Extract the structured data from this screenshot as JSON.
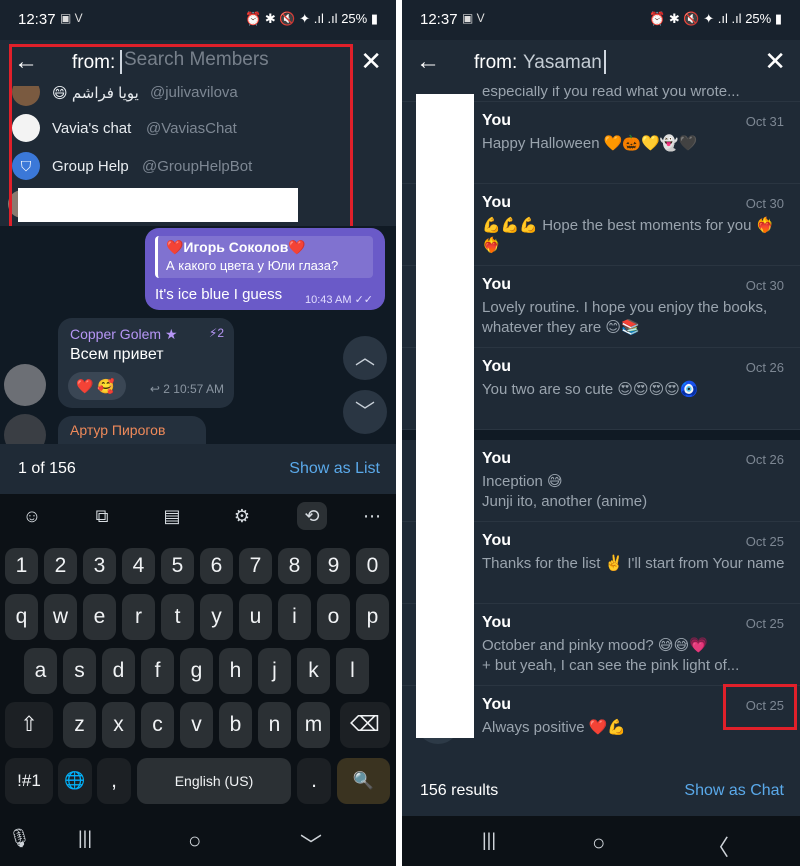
{
  "left": {
    "status": {
      "time": "12:37",
      "left_icons": "▣ V",
      "right_icons": "⏰ ✱ 🔇 ✦ .ıl .ıl",
      "battery": "25%"
    },
    "search": {
      "prefix": "from:",
      "placeholder": "Search Members"
    },
    "members": [
      {
        "name": "يويا فراشم",
        "username": "@julivavilova",
        "emoji": "😄"
      },
      {
        "name": "Vavia's chat",
        "username": "@VaviasChat"
      },
      {
        "name": "Group Help",
        "username": "@GroupHelpBot"
      }
    ],
    "chat": {
      "outgoing": {
        "reply_name": "❤️Игорь Соколов❤️",
        "reply_text": "А какого цвета у Юли глаза?",
        "text": "It's ice blue I guess",
        "time": "10:43 AM",
        "ticks": "✓✓"
      },
      "incoming": {
        "sender": "Copper Golem",
        "star": "★",
        "boost": "⚡2",
        "text": "Всем привет",
        "reactions": "❤️ 🥰",
        "reply_count": "↩ 2",
        "time": "10:57 AM"
      },
      "peek_sender": "Артур Пирогов"
    },
    "result_bar": {
      "count": "1 of 156",
      "action": "Show as List"
    },
    "keyboard": {
      "tools": [
        "☺",
        "⧉",
        "▤",
        "⚙",
        "⟲",
        "⋯"
      ],
      "numbers": [
        "1",
        "2",
        "3",
        "4",
        "5",
        "6",
        "7",
        "8",
        "9",
        "0"
      ],
      "row1": [
        "q",
        "w",
        "e",
        "r",
        "t",
        "y",
        "u",
        "i",
        "o",
        "p"
      ],
      "row2": [
        "a",
        "s",
        "d",
        "f",
        "g",
        "h",
        "j",
        "k",
        "l"
      ],
      "row3": [
        "z",
        "x",
        "c",
        "v",
        "b",
        "n",
        "m"
      ],
      "shift": "⇧",
      "backspace": "⌫",
      "sym": "!#1",
      "globe": "🌐",
      "comma": ",",
      "space": "English (US)",
      "period": ".",
      "search": "🔍"
    },
    "navbar": {
      "recents": "|||",
      "home": "○",
      "back": "﹀"
    }
  },
  "right": {
    "status": {
      "time": "12:37",
      "left_icons": "▣ V",
      "right_icons": "⏰ ✱ 🔇 ✦ .ıl .ıl",
      "battery": "25%"
    },
    "search": {
      "prefix": "from:",
      "value": "Yasaman"
    },
    "partial_text": "especially if you read what you wrote...",
    "results": [
      {
        "sender": "You",
        "date": "Oct 31",
        "text": "Happy Halloween 🧡🎃💛👻🖤"
      },
      {
        "sender": "You",
        "date": "Oct 30",
        "text": "💪💪💪 Hope the best moments for you ❤️‍🔥❤️‍🔥"
      },
      {
        "sender": "You",
        "date": "Oct 30",
        "text": "Lovely routine. I hope you enjoy the books, whatever they are 😊📚"
      },
      {
        "sender": "You",
        "date": "Oct 26",
        "text": "You two are so cute 😍😍😍😍🧿"
      },
      {
        "sender": "You",
        "date": "Oct 26",
        "text": "Inception 😅\nJunji ito, another (anime)"
      },
      {
        "sender": "You",
        "date": "Oct 25",
        "text": "Thanks for the list ✌️ I'll start from Your name"
      },
      {
        "sender": "You",
        "date": "Oct 25",
        "text": "October and pinky mood? 😅😅💗\n+ but yeah, I can see the pink light of..."
      },
      {
        "sender": "You",
        "date": "Oct 25",
        "text": "Always positive ❤️💪"
      }
    ],
    "result_bar": {
      "count": "156 results",
      "action": "Show as Chat"
    },
    "navbar": {
      "recents": "|||",
      "home": "○",
      "back": "〈"
    }
  },
  "colors": {
    "accent_link": "#5aa9ea",
    "highlight_red": "#e0202a",
    "bubble_out": "#6a5ac8"
  }
}
